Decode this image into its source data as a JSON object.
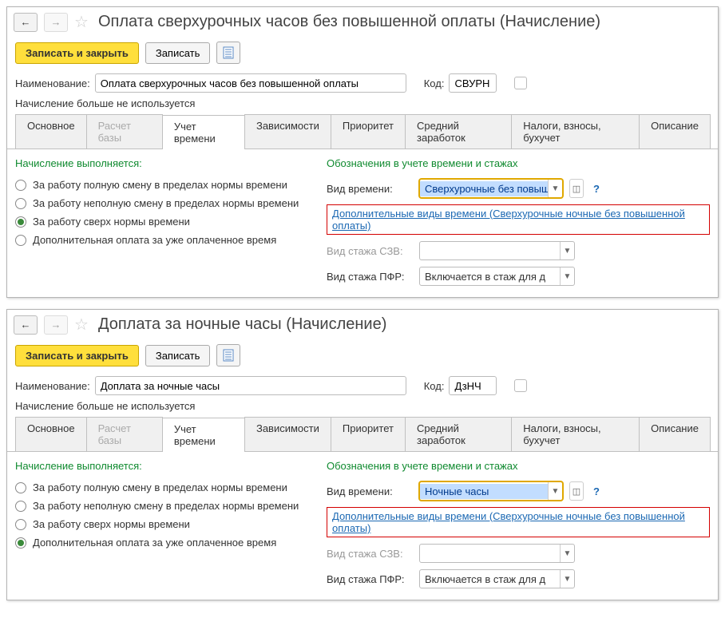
{
  "windows": [
    {
      "title": "Оплата сверхурочных часов без повышенной оплаты (Начисление)",
      "save_close": "Записать и закрыть",
      "save": "Записать",
      "name_label": "Наименование:",
      "name_value": "Оплата сверхурочных часов без повышенной оплаты",
      "code_label": "Код:",
      "code_value": "СВУРН",
      "not_used_label": "Начисление больше не используется",
      "tabs": [
        "Основное",
        "Расчет базы",
        "Учет времени",
        "Зависимости",
        "Приоритет",
        "Средний заработок",
        "Налоги, взносы, бухучет",
        "Описание"
      ],
      "active_tab": 2,
      "disabled_tab": 1,
      "left_title": "Начисление выполняется:",
      "radios": [
        "За работу полную смену в пределах нормы времени",
        "За работу неполную смену в пределах нормы времени",
        "За работу сверх нормы времени",
        "Дополнительная оплата за уже оплаченное время"
      ],
      "radio_checked": 2,
      "right_title": "Обозначения в учете времени и стажах",
      "vid_vremeni_label": "Вид времени:",
      "vid_vremeni_value": "Сверхурочные без повыш",
      "extra_link": "Дополнительные виды времени (Сверхурочные ночные без повышенной оплаты)",
      "stazh_szv_label": "Вид стажа СЗВ:",
      "stazh_szv_value": "",
      "stazh_pfr_label": "Вид стажа ПФР:",
      "stazh_pfr_value": "Включается в стаж для д"
    },
    {
      "title": "Доплата за ночные часы (Начисление)",
      "save_close": "Записать и закрыть",
      "save": "Записать",
      "name_label": "Наименование:",
      "name_value": "Доплата за ночные часы",
      "code_label": "Код:",
      "code_value": "ДзНЧ",
      "not_used_label": "Начисление больше не используется",
      "tabs": [
        "Основное",
        "Расчет базы",
        "Учет времени",
        "Зависимости",
        "Приоритет",
        "Средний заработок",
        "Налоги, взносы, бухучет",
        "Описание"
      ],
      "active_tab": 2,
      "disabled_tab": 1,
      "left_title": "Начисление выполняется:",
      "radios": [
        "За работу полную смену в пределах нормы времени",
        "За работу неполную смену в пределах нормы времени",
        "За работу сверх нормы времени",
        "Дополнительная оплата за уже оплаченное время"
      ],
      "radio_checked": 3,
      "right_title": "Обозначения в учете времени и стажах",
      "vid_vremeni_label": "Вид времени:",
      "vid_vremeni_value": "Ночные часы",
      "extra_link": "Дополнительные виды времени (Сверхурочные ночные без повышенной оплаты)",
      "stazh_szv_label": "Вид стажа СЗВ:",
      "stazh_szv_value": "",
      "stazh_pfr_label": "Вид стажа ПФР:",
      "stazh_pfr_value": "Включается в стаж для д"
    }
  ]
}
